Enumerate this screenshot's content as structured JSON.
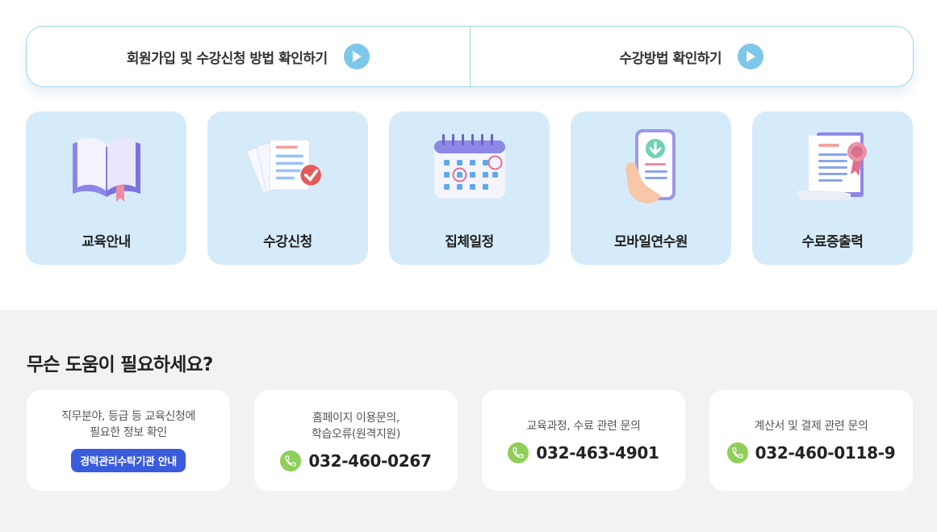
{
  "guide": {
    "items": [
      {
        "label": "회원가입 및 수강신청 방법 확인하기",
        "icon": "play-icon"
      },
      {
        "label": "수강방법 확인하기",
        "icon": "play-icon"
      }
    ]
  },
  "menu": {
    "items": [
      {
        "label": "교육안내",
        "icon": "open-book-icon"
      },
      {
        "label": "수강신청",
        "icon": "documents-check-icon"
      },
      {
        "label": "집체일정",
        "icon": "calendar-icon"
      },
      {
        "label": "모바일연수원",
        "icon": "mobile-download-icon"
      },
      {
        "label": "수료증출력",
        "icon": "certificate-icon"
      }
    ]
  },
  "help": {
    "title": "무슨 도움이 필요하세요?",
    "cards": [
      {
        "desc_line1": "직무분야, 등급 등 교육신청에",
        "desc_line2": "필요한 정보 확인",
        "badge": "경력관리수탁기관 안내"
      },
      {
        "desc_line1": "홈페이지 이용문의,",
        "desc_line2": "학습오류(원격지원)",
        "phone": "032-460-0267"
      },
      {
        "desc_line1": "교육과정, 수료 관련 문의",
        "phone": "032-463-4901"
      },
      {
        "desc_line1": "계산서 및 결제 관련 문의",
        "phone": "032-460-0118-9"
      }
    ]
  },
  "colors": {
    "accent_blue": "#3a5bdc",
    "card_bg": "#d6ebfa",
    "phone_green": "#8fcf5a",
    "play_blue": "#7ec6ea"
  }
}
